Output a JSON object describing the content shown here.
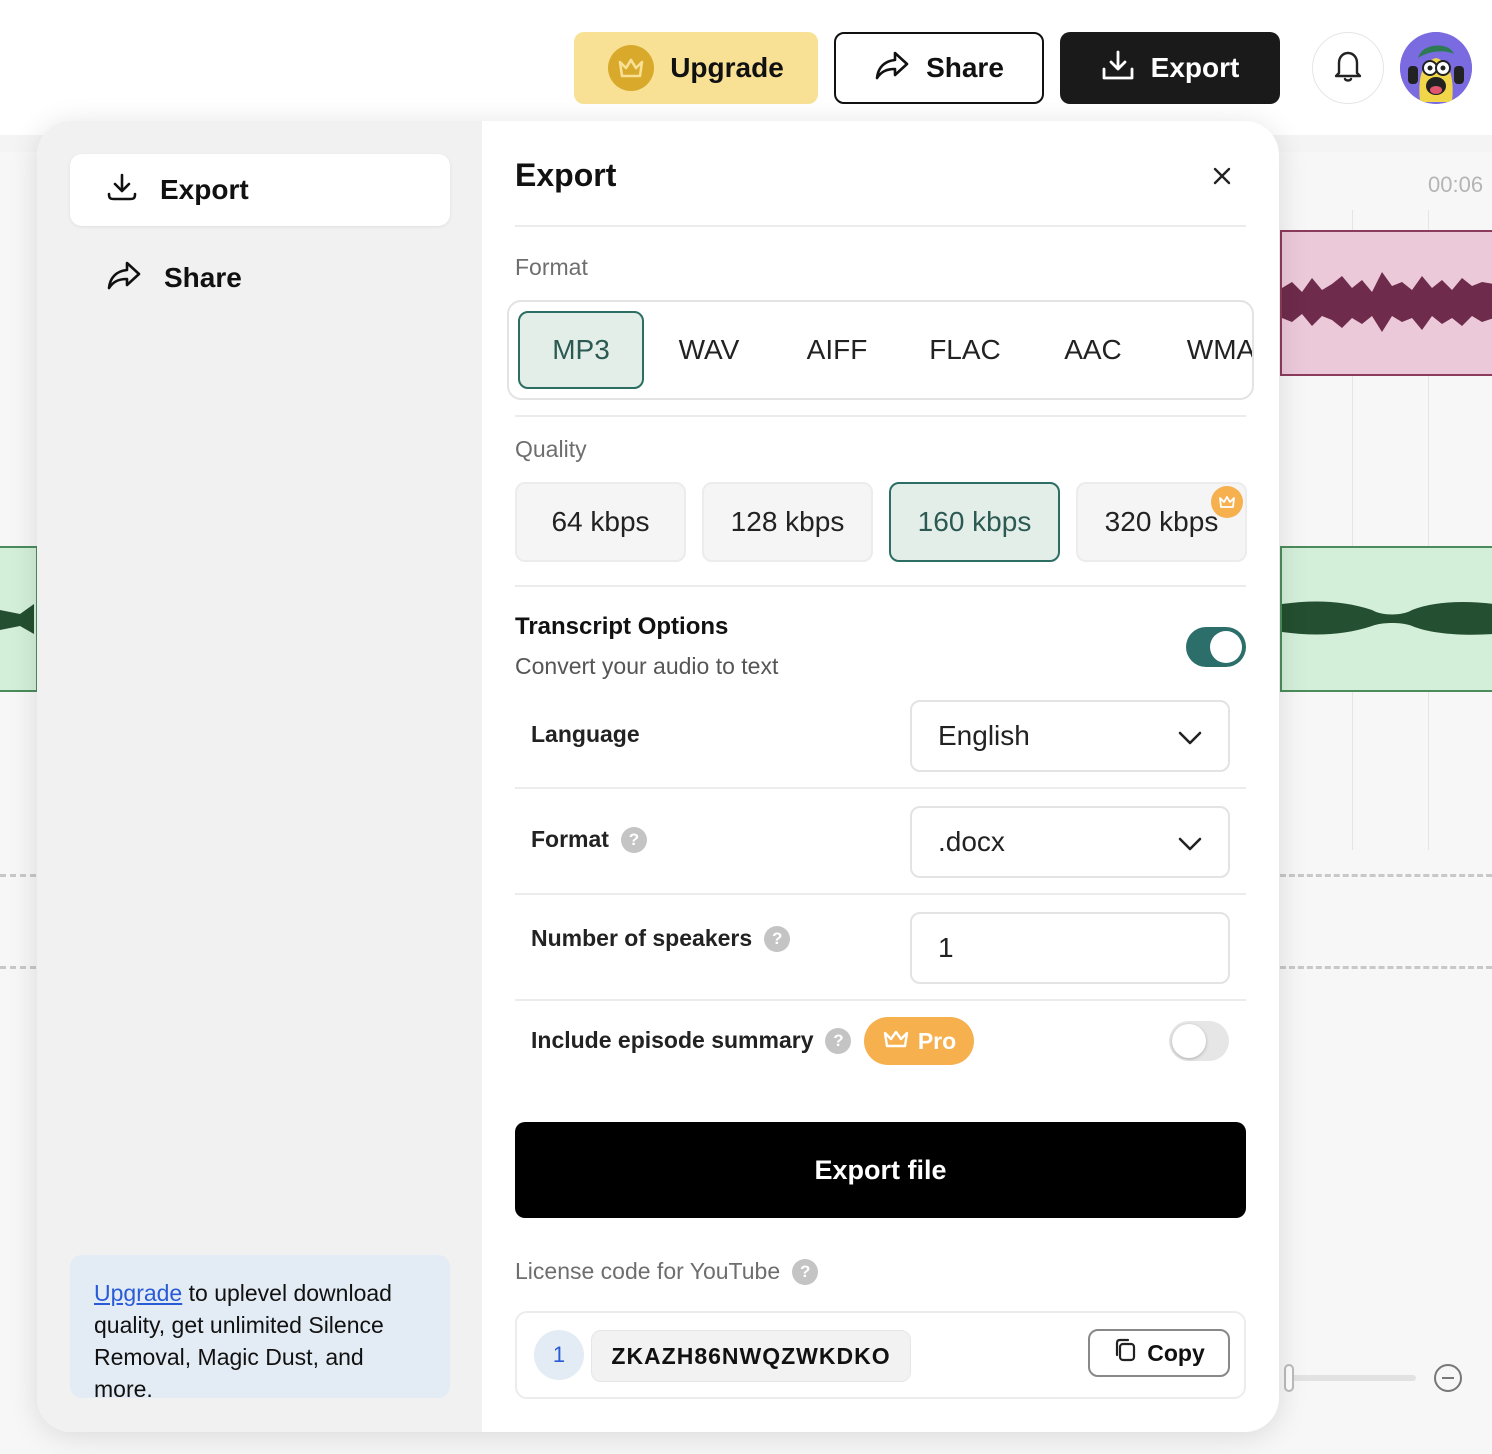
{
  "topbar": {
    "upgrade_label": "Upgrade",
    "share_label": "Share",
    "export_label": "Export"
  },
  "background": {
    "timecode": "00:06"
  },
  "sidebar": {
    "items": [
      {
        "label": "Export",
        "icon": "download-icon",
        "active": true
      },
      {
        "label": "Share",
        "icon": "share-arrow-icon",
        "active": false
      }
    ],
    "upgrade_link": "Upgrade",
    "upgrade_text": " to uplevel download quality, get unlimited Silence Removal, Magic Dust, and more."
  },
  "panel": {
    "title": "Export",
    "format_label": "Format",
    "formats": [
      "MP3",
      "WAV",
      "AIFF",
      "FLAC",
      "AAC",
      "WMA"
    ],
    "selected_format": "MP3",
    "quality_label": "Quality",
    "qualities": [
      "64 kbps",
      "128 kbps",
      "160 kbps",
      "320 kbps"
    ],
    "selected_quality": "160 kbps",
    "transcript": {
      "title": "Transcript Options",
      "subtitle": "Convert your audio to text",
      "enabled": true,
      "language_label": "Language",
      "language_value": "English",
      "format_label": "Format",
      "format_value": ".docx",
      "speakers_label": "Number of speakers",
      "speakers_value": "1",
      "summary_label": "Include episode summary",
      "pro_badge": "Pro",
      "summary_enabled": false
    },
    "export_button": "Export file",
    "license_label": "License code for YouTube",
    "license_index": "1",
    "license_code": "ZKAZH86NWQZWKDKO",
    "copy_label": "Copy"
  },
  "colors": {
    "upgrade_bg": "#f8e095",
    "selected_bg": "#e3eee9",
    "selected_border": "#2c6e63",
    "pro_orange": "#f6b04e",
    "link_blue": "#2a5bd7"
  }
}
